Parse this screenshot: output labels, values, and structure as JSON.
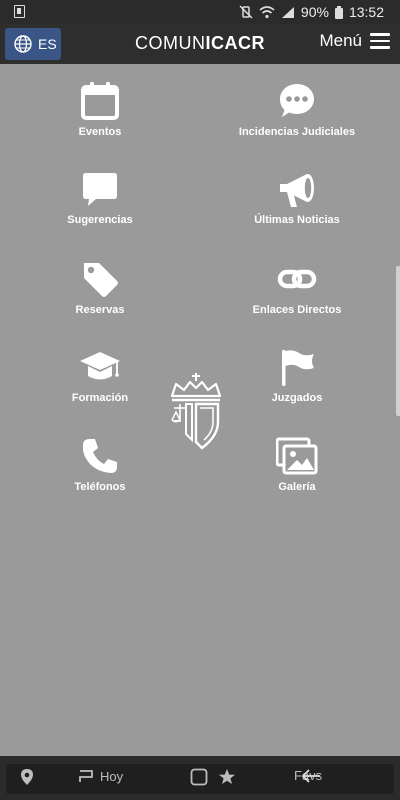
{
  "status_bar": {
    "battery": "90%",
    "time": "13:52"
  },
  "app_bar": {
    "language": "ES",
    "brand_light": "COMUN",
    "brand_bold": "ICACR",
    "menu_label": "Menú"
  },
  "grid": {
    "eventos": "Eventos",
    "incidencias": "Incidencias Judiciales",
    "sugerencias": "Sugerencias",
    "noticias": "Últimas Noticias",
    "reservas": "Reservas",
    "enlaces": "Enlaces Directos",
    "formacion": "Formación",
    "juzgados": "Juzgados",
    "telefonos": "Teléfonos",
    "galeria": "Galería"
  },
  "bottom_bar": {
    "hoy": "Hoy",
    "favs": "Favs"
  },
  "colors": {
    "background": "#9a9a9a",
    "app_bar": "#2e2e2e",
    "language_button": "#3a5687",
    "icon": "#ffffff"
  }
}
